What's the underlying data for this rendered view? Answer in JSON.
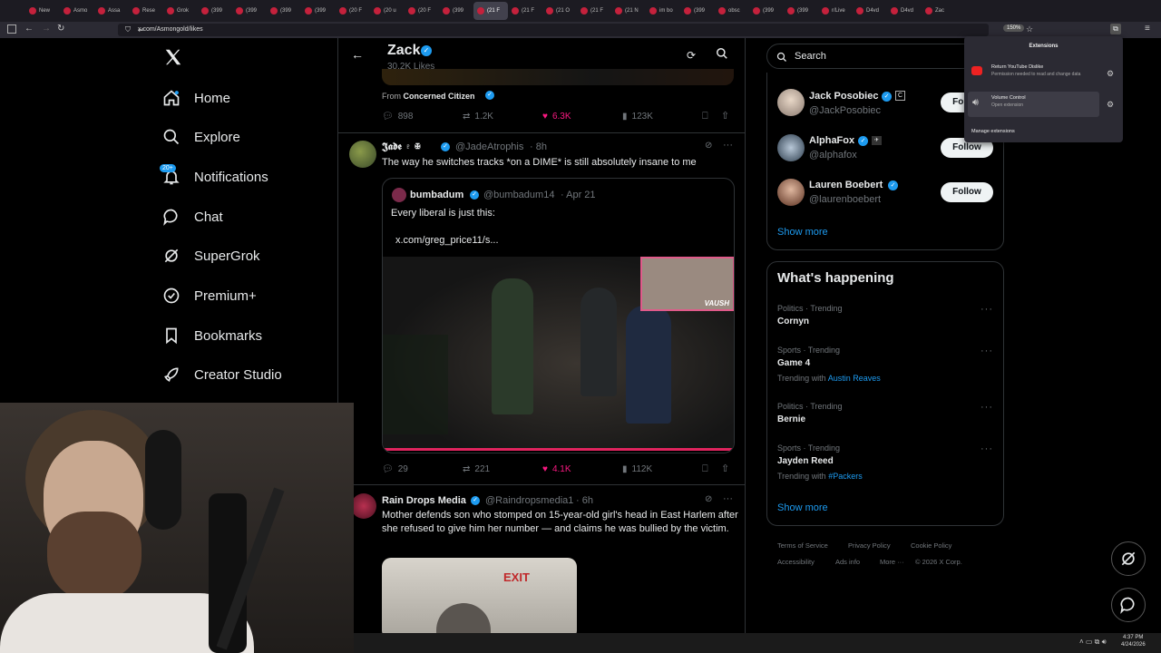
{
  "browser": {
    "tabs": [
      {
        "label": "New"
      },
      {
        "label": "Asmo"
      },
      {
        "label": "Assa"
      },
      {
        "label": "Rese"
      },
      {
        "label": "Grok"
      },
      {
        "label": "(399"
      },
      {
        "label": "(399"
      },
      {
        "label": "(399"
      },
      {
        "label": "(399"
      },
      {
        "label": "(20 F"
      },
      {
        "label": "(20 u"
      },
      {
        "label": "(20 F"
      },
      {
        "label": "(399"
      },
      {
        "label": "(21 F",
        "active": true
      },
      {
        "label": "(21 F"
      },
      {
        "label": "(21 O"
      },
      {
        "label": "(21 F"
      },
      {
        "label": "(21 N"
      },
      {
        "label": "im bo"
      },
      {
        "label": "(399"
      },
      {
        "label": "obsc"
      },
      {
        "label": "(399"
      },
      {
        "label": "(399"
      },
      {
        "label": "r/Live"
      },
      {
        "label": "D4vd"
      },
      {
        "label": "D4vd"
      },
      {
        "label": "Zac"
      }
    ],
    "url": "x.com/Asmongold/likes",
    "zoom": "150%"
  },
  "extensions_panel": {
    "title": "Extensions",
    "items": [
      {
        "name": "Return YouTube Dislike",
        "desc": "Permission needed to read and change data"
      },
      {
        "name": "Volume Control",
        "desc": "Open extension"
      }
    ],
    "manage_label": "Manage extensions"
  },
  "sidebar": {
    "items": [
      {
        "label": "Home",
        "icon": "home-icon"
      },
      {
        "label": "Explore",
        "icon": "search-icon"
      },
      {
        "label": "Notifications",
        "icon": "bell-icon",
        "badge": "20+"
      },
      {
        "label": "Chat",
        "icon": "chat-icon"
      },
      {
        "label": "SuperGrok",
        "icon": "grok-icon"
      },
      {
        "label": "Premium+",
        "icon": "verified-icon"
      },
      {
        "label": "Bookmarks",
        "icon": "bookmark-icon"
      },
      {
        "label": "Creator Studio",
        "icon": "rocket-icon"
      }
    ]
  },
  "profile_header": {
    "name": "Zack",
    "likes_count": "30.2K Likes"
  },
  "tweets": [
    {
      "quoted_from_label": "From",
      "quoted_from": "Concerned Citizen",
      "replies": "898",
      "retweets": "1.2K",
      "likes": "6.3K",
      "views": "123K"
    },
    {
      "author": "𝕵𝖆𝖉𝖊 ♇ ✠",
      "handle": "@JadeAtrophis",
      "time": "· 8h",
      "text": "The way he switches tracks *on a DIME* is still absolutely insane to me",
      "quote": {
        "author": "bumbadum",
        "handle": "@bumbadum14",
        "time": "· Apr 21",
        "text": "Every liberal is just this:",
        "link": "x.com/greg_price11/s...",
        "video_overlay_label": "VAUSH"
      },
      "replies": "29",
      "retweets": "221",
      "likes": "4.1K",
      "views": "112K"
    },
    {
      "author": "Rain Drops Media",
      "handle": "@Raindropsmedia1",
      "time": "· 6h",
      "text": "Mother defends son who stomped on 15-year-old girl's head in East Harlem after she refused to give him her number — and claims he was bullied by the victim.",
      "image_sign": "EXIT"
    }
  ],
  "search": {
    "placeholder": "Search"
  },
  "who_to_follow": {
    "users": [
      {
        "name": "Jack Posobiec",
        "handle": "@JackPosobiec",
        "button": "Follow"
      },
      {
        "name": "AlphaFox",
        "handle": "@alphafox",
        "button": "Follow"
      },
      {
        "name": "Lauren Boebert",
        "handle": "@laurenboebert",
        "button": "Follow"
      }
    ],
    "show_more": "Show more"
  },
  "whats_happening": {
    "title": "What's happening",
    "trends": [
      {
        "category": "Politics · Trending",
        "name": "Cornyn"
      },
      {
        "category": "Sports · Trending",
        "name": "Game 4",
        "with_label": "Trending with",
        "with_link": "Austin Reaves"
      },
      {
        "category": "Politics · Trending",
        "name": "Bernie"
      },
      {
        "category": "Sports · Trending",
        "name": "Jayden Reed",
        "with_label": "Trending with",
        "with_link": "#Packers"
      }
    ],
    "show_more": "Show more"
  },
  "footer": {
    "links": [
      "Terms of Service",
      "Privacy Policy",
      "Cookie Policy",
      "Accessibility",
      "Ads info",
      "More ···",
      "© 2026 X Corp."
    ]
  },
  "taskbar": {
    "time": "4:37 PM",
    "date": "4/24/2026"
  },
  "colors": {
    "accent": "#1d9bf0",
    "like": "#f91880",
    "background": "#000000"
  }
}
